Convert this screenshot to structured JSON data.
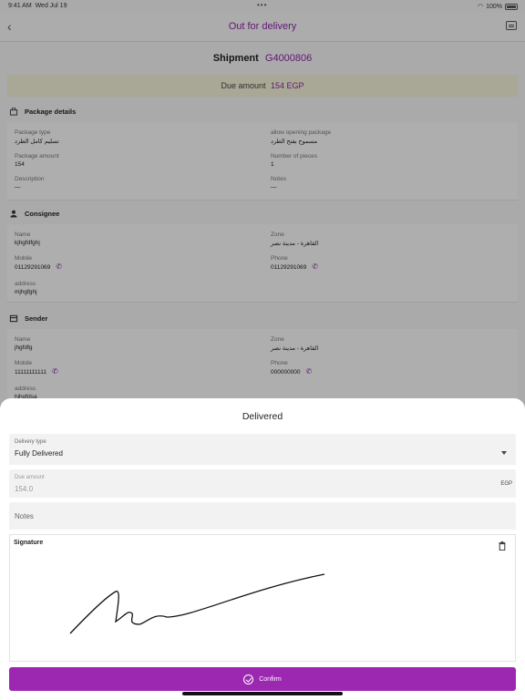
{
  "status_bar": {
    "time": "9:41 AM",
    "date": "Wed Jul 19",
    "battery": "100%"
  },
  "nav": {
    "title": "Out for delivery"
  },
  "shipment": {
    "label": "Shipment",
    "code": "G4000806"
  },
  "due": {
    "label": "Due amount",
    "amount": "154 EGP"
  },
  "package": {
    "title": "Package details",
    "type_label": "Package type",
    "type_value": "تسليم كامل الطرد",
    "opening_label": "allow opening package",
    "opening_value": "مسموح بفتح الطرد",
    "amount_label": "Package amount",
    "amount_value": "154",
    "pieces_label": "Number of pieces",
    "pieces_value": "1",
    "desc_label": "Description",
    "desc_value": "—",
    "notes_label": "Notes",
    "notes_value": "—"
  },
  "consignee": {
    "title": "Consignee",
    "name_label": "Name",
    "name_value": "kjhgfdfghj",
    "zone_label": "Zone",
    "zone_value": "القاهرة - مدينة نصر",
    "mobile_label": "Mobile",
    "mobile_value": "01129291069",
    "phone_label": "Phone",
    "phone_value": "01129291069",
    "address_label": "address",
    "address_value": "mjhgfghj"
  },
  "sender": {
    "title": "Sender",
    "name_label": "Name",
    "name_value": "jhgfdfg",
    "zone_label": "Zone",
    "zone_value": "القاهرة - مدينة نصر",
    "mobile_label": "Mobile",
    "mobile_value": "11111111111",
    "phone_label": "Phone",
    "phone_value": "000000000",
    "address_label": "address",
    "address_value": "hjhgfdsa"
  },
  "sheet": {
    "title": "Delivered",
    "delivery_type_label": "Delivery type",
    "delivery_type_value": "Fully Delivered",
    "due_amount_label": "Due amount",
    "due_amount_value": "154.0",
    "currency": "EGP",
    "notes_placeholder": "Notes",
    "signature_label": "Signature",
    "confirm_label": "Confirm"
  },
  "colors": {
    "accent": "#9c27b0",
    "title": "#8e24aa"
  }
}
